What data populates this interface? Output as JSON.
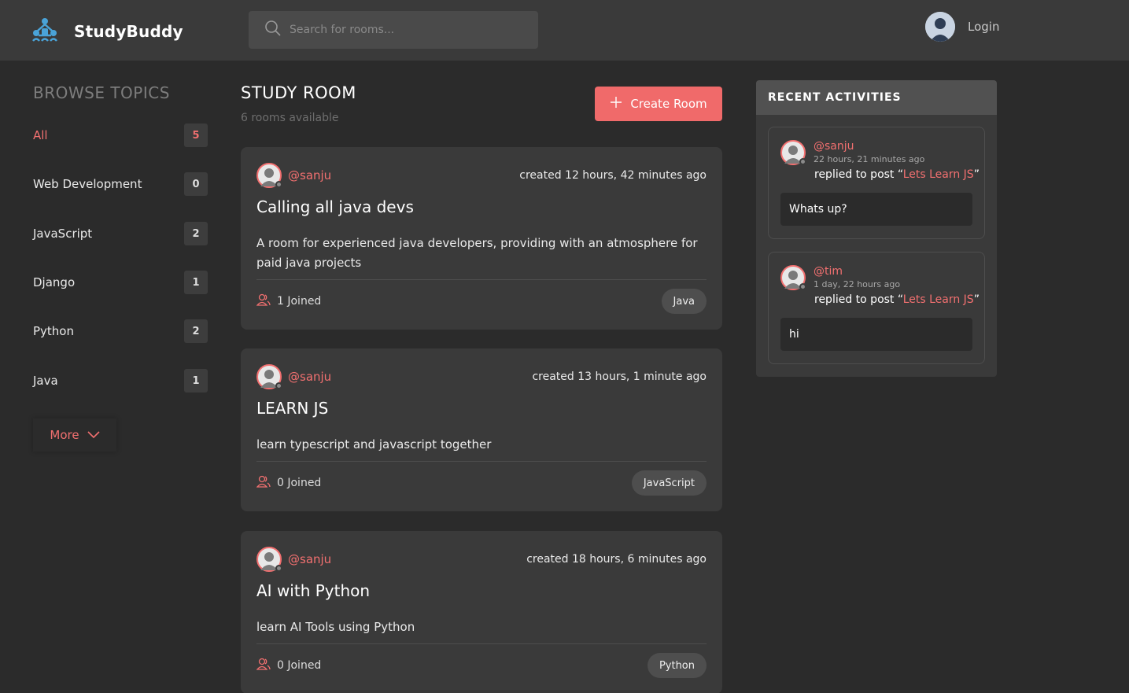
{
  "header": {
    "brand": "StudyBuddy",
    "search_placeholder": "Search for rooms...",
    "login_label": "Login"
  },
  "sidebar": {
    "title": "BROWSE TOPICS",
    "topics": [
      {
        "label": "All",
        "count": "5"
      },
      {
        "label": "Web Development",
        "count": "0"
      },
      {
        "label": "JavaScript",
        "count": "2"
      },
      {
        "label": "Django",
        "count": "1"
      },
      {
        "label": "Python",
        "count": "2"
      },
      {
        "label": "Java",
        "count": "1"
      }
    ],
    "more_label": "More"
  },
  "main": {
    "title": "STUDY ROOM",
    "subtitle": "6 rooms available",
    "create_label": "Create Room",
    "rooms": [
      {
        "host": "@sanju",
        "created": "created 12 hours, 42 minutes ago",
        "title": "Calling all java devs",
        "description": "A room for experienced java developers, providing with an atmosphere for paid java projects",
        "joined": "1 Joined",
        "topic": "Java"
      },
      {
        "host": "@sanju",
        "created": "created 13 hours, 1 minute ago",
        "title": "LEARN JS",
        "description": "learn typescript and javascript together",
        "joined": "0 Joined",
        "topic": "JavaScript"
      },
      {
        "host": "@sanju",
        "created": "created 18 hours, 6 minutes ago",
        "title": "AI with Python",
        "description": "learn AI Tools using Python",
        "joined": "0 Joined",
        "topic": "Python"
      }
    ]
  },
  "activities": {
    "title": "RECENT ACTIVITIES",
    "items": [
      {
        "user": "@sanju",
        "time": "22 hours, 21 minutes ago",
        "action": "replied to post “",
        "post": "Lets Learn JS",
        "action_end": "”",
        "message": "Whats up?"
      },
      {
        "user": "@tim",
        "time": "1 day, 22 hours ago",
        "action": "replied to post “",
        "post": "Lets Learn JS",
        "action_end": "”",
        "message": "hi"
      }
    ]
  },
  "colors": {
    "accent": "#f27070",
    "button": "#f06a6a",
    "background": "#2b2b2b",
    "card": "#3a3a3a",
    "header": "#3a3a3a",
    "logo": "#4aa3d8"
  }
}
